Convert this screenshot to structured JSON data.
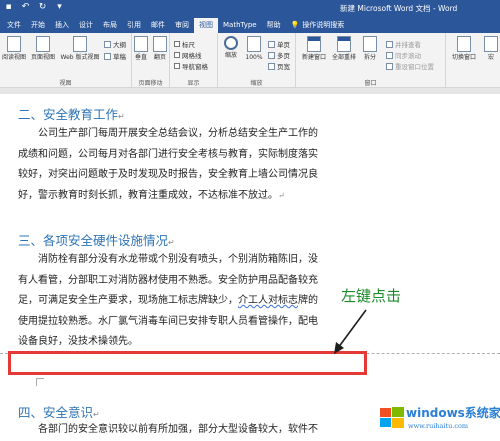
{
  "titlebar": {
    "title": "新建 Microsoft Word 文档 - Word",
    "qat": [
      "save-icon",
      "undo-icon",
      "redo-icon",
      "customize-icon"
    ]
  },
  "tabs": [
    "文件",
    "开始",
    "插入",
    "设计",
    "布局",
    "引用",
    "邮件",
    "审阅",
    "视图",
    "MathType",
    "帮助"
  ],
  "active_tab": "视图",
  "search_label": "操作说明搜索",
  "ribbon": {
    "views": {
      "buttons": [
        "阅读视图",
        "页面视图",
        "Web 版式视图"
      ],
      "small": [
        "大纲",
        "草稿"
      ],
      "label": "视图"
    },
    "page_move": {
      "buttons": [
        "垂直",
        "翻页"
      ],
      "label": "页面移动"
    },
    "show": {
      "checks": [
        "标尺",
        "网格线",
        "导航窗格"
      ],
      "label": "显示"
    },
    "zoom": {
      "buttons": [
        "缩放",
        "100%"
      ],
      "small": [
        "单页",
        "多页",
        "页宽"
      ],
      "label": "缩放"
    },
    "window": {
      "buttons": [
        "新建窗口",
        "全部重排",
        "拆分"
      ],
      "small": [
        "并排查看",
        "同步滚动",
        "重设窗口位置"
      ],
      "label": "窗口"
    },
    "switch": {
      "button": "切换窗口"
    },
    "macro": {
      "button": "宏"
    }
  },
  "document": {
    "heading1": "二、安全教育工作",
    "para1": [
      "公司生产部门每周开展安全总结会议，分析总结安全生产工作的",
      "成绩和问题，公司每月对各部门进行安全考核与教育，实际制度落实",
      "较好，对突出问题敢于及时发现及时报告，安全教育上墙公司情况良",
      "好，警示教育时刻长抓，教育注重成效，不达标准不放过。"
    ],
    "heading2": "三、各项安全硬件设施情况",
    "para2": [
      "消防栓有部分没有水龙带或个别没有喷头，个别消防箱陈旧，没",
      "有人看管，分部职工对消防器材使用不熟悉。安全防护用品配备较充",
      "足，可满足安全生产要求，现场施工标志牌缺少，",
      "使用提拉较熟悉。水厂氯气消毒车间已安排专职人员看管操作，配电",
      "设备良好，没技术操领先。"
    ],
    "para2_line3_wavy": "介工人对标志",
    "para2_line3_end": "牌的",
    "heading3": "四、安全意识",
    "para3_partial": "各部门的安全意识较以前有所加强，部分大型设备较大，软件不"
  },
  "annotation": "左键点击",
  "watermark": {
    "name": "windows系统家园",
    "url": "www.ruihaitu.com"
  },
  "colors": {
    "titlebar": "#2b579a",
    "heading": "#2e74b5",
    "annotation": "#1e8a2b",
    "highlight_box": "#e53935"
  }
}
